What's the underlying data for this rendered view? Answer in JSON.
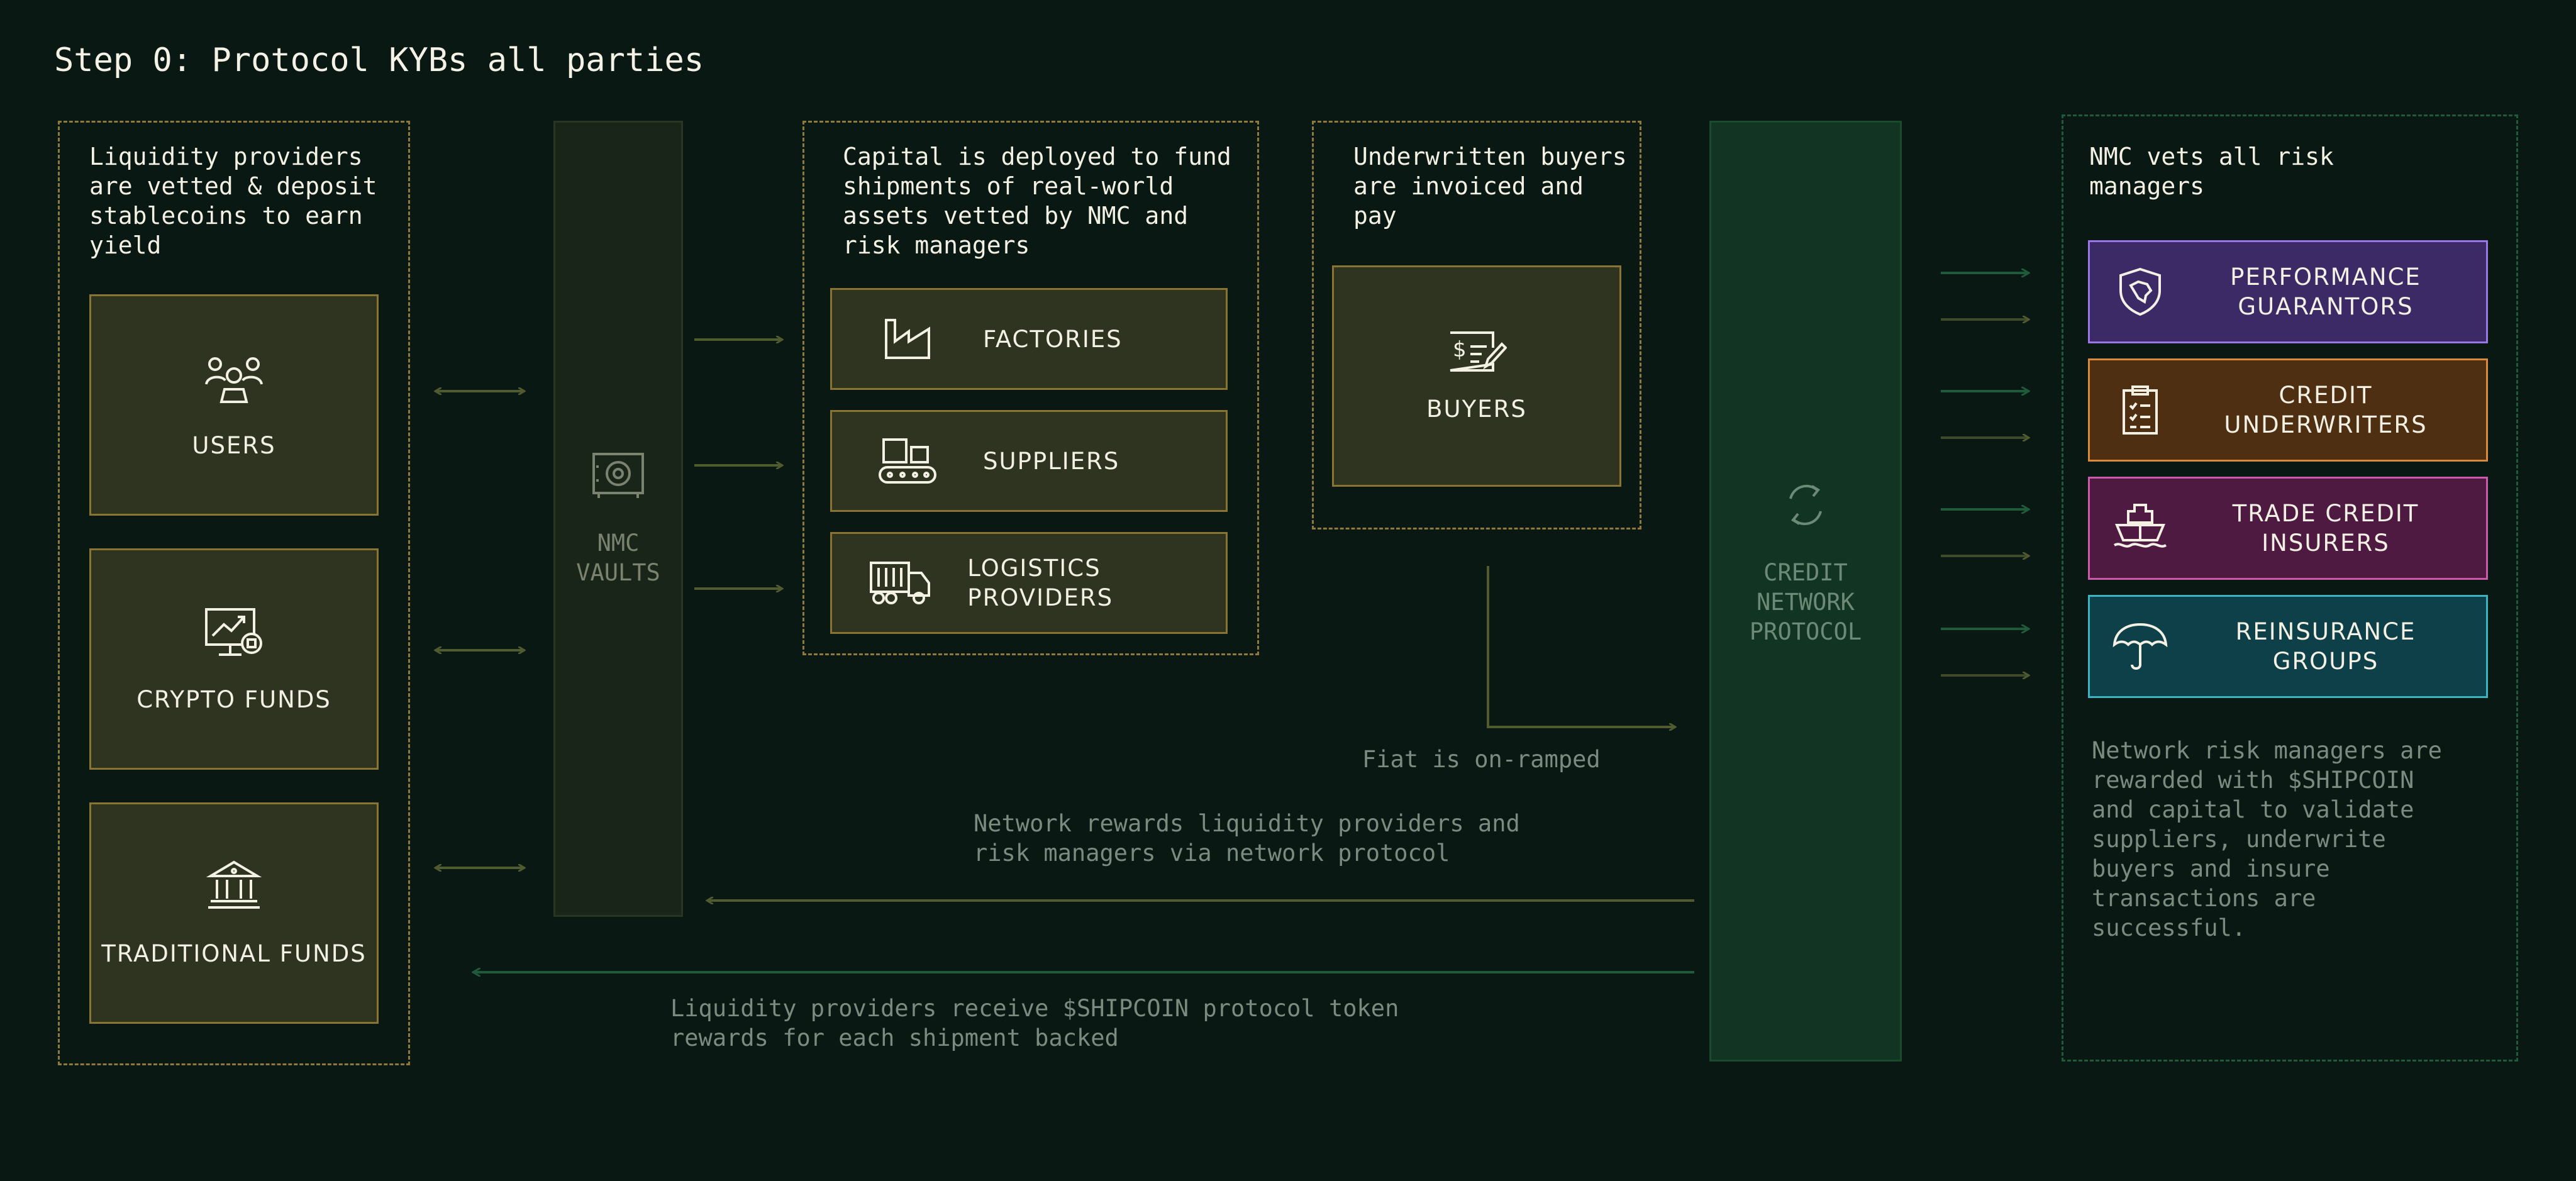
{
  "title": "Step 0: Protocol KYBs all parties",
  "liquidity": {
    "description": "Liquidity providers are vetted & deposit stablecoins to earn yield",
    "cards": [
      {
        "label": "USERS",
        "icon": "users-icon"
      },
      {
        "label": "CRYPTO FUNDS",
        "icon": "chart-monitor-icon"
      },
      {
        "label": "TRADITIONAL FUNDS",
        "icon": "bank-icon"
      }
    ]
  },
  "vaults": {
    "label": "NMC VAULTS",
    "icon": "safe-icon"
  },
  "capital": {
    "description": "Capital is deployed to fund shipments of real-world assets vetted by NMC and risk managers",
    "cards": [
      {
        "label": "FACTORIES",
        "icon": "factory-icon"
      },
      {
        "label": "SUPPLIERS",
        "icon": "conveyor-icon"
      },
      {
        "label": "LOGISTICS PROVIDERS",
        "icon": "truck-icon"
      }
    ]
  },
  "buyers": {
    "description": "Underwritten buyers are invoiced and pay",
    "label": "BUYERS",
    "icon": "invoice-icon"
  },
  "fiat_note": "Fiat is on-ramped",
  "protocol": {
    "label": "CREDIT NETWORK PROTOCOL",
    "icon": "cycle-icon"
  },
  "risk": {
    "description": "NMC vets all risk managers",
    "managers": [
      {
        "label": "PERFORMANCE GUARANTORS",
        "icon": "shield-icon",
        "bg": "#3b2a66",
        "border": "#9a76e8"
      },
      {
        "label": "CREDIT UNDERWRITERS",
        "icon": "clipboard-icon",
        "bg": "#4f2f12",
        "border": "#d98a3a"
      },
      {
        "label": "TRADE CREDIT INSURERS",
        "icon": "ship-icon",
        "bg": "#4e1a42",
        "border": "#cc5aaa"
      },
      {
        "label": "REINSURANCE GROUPS",
        "icon": "umbrella-icon",
        "bg": "#0d4048",
        "border": "#3bb4c4"
      }
    ],
    "note": "Network risk managers are rewarded with $SHIPCOIN and capital to validate suppliers, underwrite buyers and insure transactions are successful."
  },
  "rewards_note": "Network rewards liquidity providers and risk managers via network protocol",
  "token_note": "Liquidity providers receive $SHIPCOIN protocol token rewards for each shipment backed",
  "colors": {
    "background": "#0a1813",
    "card": "#2f3420",
    "card_border": "#8a7434",
    "olive_arrow": "#505b30",
    "green_arrow": "#1f5a3a"
  }
}
